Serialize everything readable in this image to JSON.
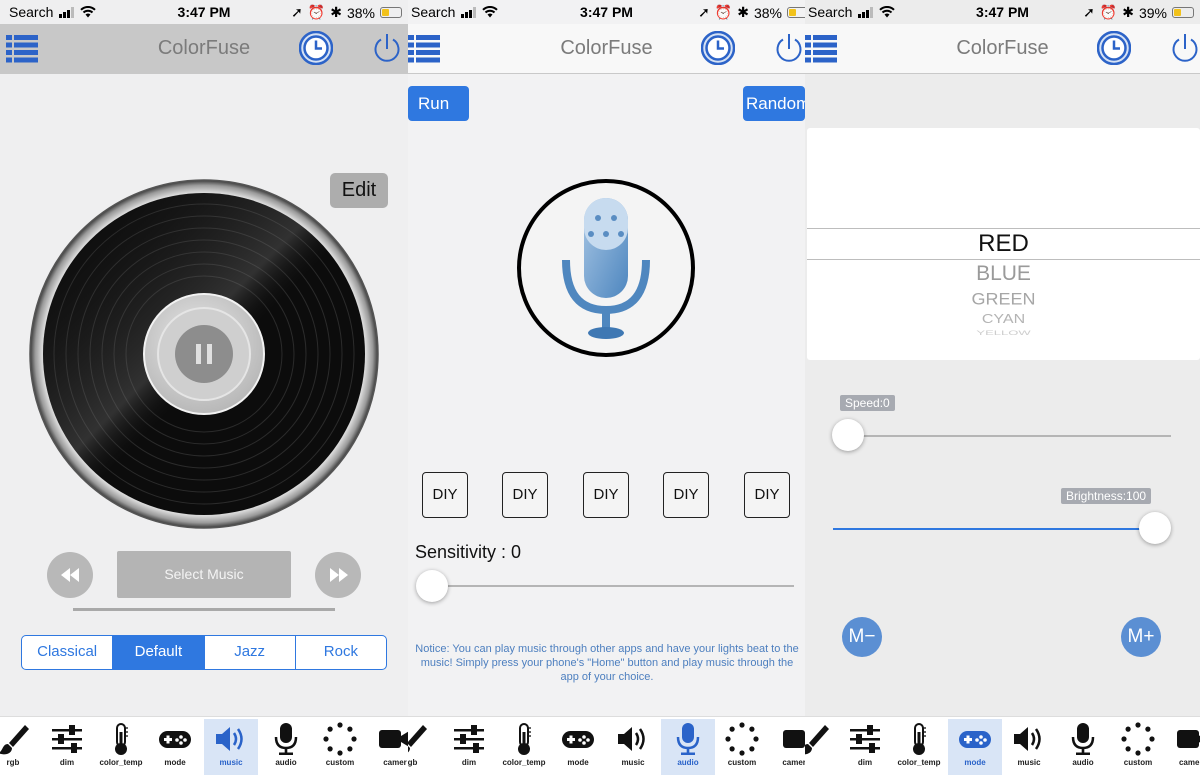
{
  "panels": [
    {
      "status": {
        "carrier": "Search",
        "time": "3:47 PM",
        "battery": "38%",
        "battery_level": 0.38
      },
      "title": "ColorFuse"
    },
    {
      "status": {
        "carrier": "Search",
        "time": "3:47 PM",
        "battery": "38%",
        "battery_level": 0.38
      },
      "title": "ColorFuse"
    },
    {
      "status": {
        "carrier": "Search",
        "time": "3:47 PM",
        "battery": "39%",
        "battery_level": 0.39
      },
      "title": "ColorFuse"
    }
  ],
  "music": {
    "edit_label": "Edit",
    "select_music_label": "Select Music",
    "segments": [
      "Classical",
      "Default",
      "Jazz",
      "Rock"
    ],
    "selected_segment": "Default"
  },
  "audio": {
    "run_label": "Run",
    "random_label": "Random",
    "diy_labels": [
      "DIY",
      "DIY",
      "DIY",
      "DIY",
      "DIY"
    ],
    "sensitivity_label": "Sensitivity : 0",
    "sensitivity_value": 0,
    "notice": "Notice: You can play music through other apps and have your lights beat to the music! Simply press your phone's \"Home\" button and play music through the app of your choice."
  },
  "mode": {
    "picker_items": [
      "RED",
      "BLUE",
      "GREEN",
      "CYAN",
      "YELLOW"
    ],
    "selected": "RED",
    "speed_label": "Speed:0",
    "speed_value": 0,
    "brightness_label": "Brightness:100",
    "brightness_value": 100,
    "m_minus": "M−",
    "m_plus": "M+"
  },
  "tabbars": [
    {
      "tabs": [
        "rgb",
        "dim",
        "color_temp",
        "mode",
        "music",
        "audio",
        "custom",
        "camer"
      ],
      "active": "music"
    },
    {
      "tabs": [
        "rgb",
        "dim",
        "color_temp",
        "mode",
        "music",
        "audio",
        "custom",
        "camergb"
      ],
      "active": "audio"
    },
    {
      "tabs": [
        "dim",
        "color_temp",
        "mode",
        "music",
        "audio",
        "custom",
        "camera"
      ],
      "active": "mode"
    }
  ],
  "colors": {
    "accent": "#2f78e0",
    "nav_icon": "#2c63c8",
    "tab_active_bg": "#d9e5f6"
  }
}
